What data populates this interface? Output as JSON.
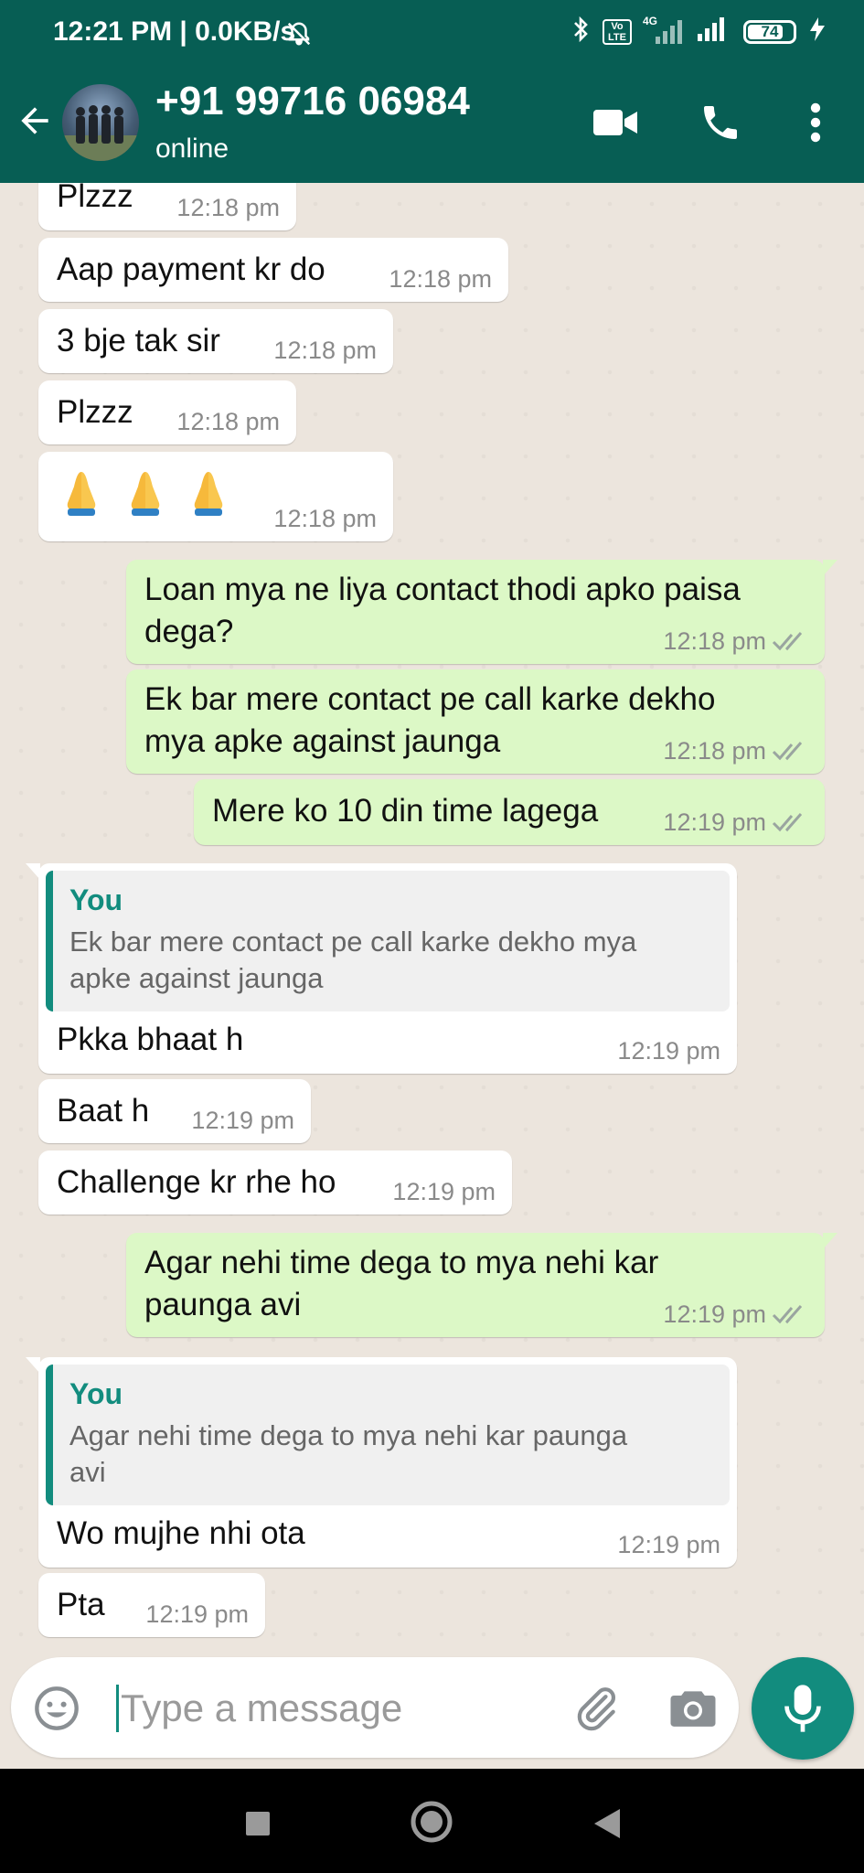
{
  "status_bar": {
    "time_speed": "12:21 PM | 0.0KB/s",
    "network": "4G",
    "volte": "Vo LTE",
    "battery": "74"
  },
  "header": {
    "contact_name": "+91 99716 06984",
    "status": "online"
  },
  "messages": [
    {
      "dir": "in",
      "text": "Plzzz",
      "time": "12:18 pm"
    },
    {
      "dir": "in",
      "text": "Aap payment kr do",
      "time": "12:18 pm"
    },
    {
      "dir": "in",
      "text": "3 bje tak sir",
      "time": "12:18 pm"
    },
    {
      "dir": "in",
      "text": "Plzzz",
      "time": "12:18 pm"
    },
    {
      "dir": "in",
      "emoji": "folded-hands x3",
      "time": "12:18 pm"
    },
    {
      "dir": "out",
      "text": "Loan mya ne liya contact thodi apko paisa\ndega?",
      "time": "12:18 pm"
    },
    {
      "dir": "out",
      "text": "Ek bar mere contact pe call karke dekho\nmya apke against jaunga",
      "time": "12:18 pm"
    },
    {
      "dir": "out",
      "text": "Mere ko 10 din time lagega",
      "time": "12:19 pm"
    },
    {
      "dir": "in",
      "quote_name": "You",
      "quote_text": "Ek bar mere contact pe call karke dekho mya\napke against jaunga",
      "text": "Pkka bhaat h",
      "time": "12:19 pm"
    },
    {
      "dir": "in",
      "text": "Baat h",
      "time": "12:19 pm"
    },
    {
      "dir": "in",
      "text": "Challenge kr rhe ho",
      "time": "12:19 pm"
    },
    {
      "dir": "out",
      "text": "Agar nehi time dega to mya nehi kar\npaunga avi",
      "time": "12:19 pm"
    },
    {
      "dir": "in",
      "quote_name": "You",
      "quote_text": "Agar nehi time dega to mya nehi kar paunga\navi",
      "text": "Wo mujhe nhi ota",
      "time": "12:19 pm"
    },
    {
      "dir": "in",
      "text": "Pta",
      "time": "12:19 pm"
    }
  ],
  "input": {
    "placeholder": "Type a message"
  },
  "colors": {
    "header": "#075e54",
    "accent": "#128c7e",
    "outgoing_bubble": "#dcf8c6",
    "incoming_bubble": "#ffffff",
    "chat_background": "#ece5dd",
    "read_ticks": "#9aa5a0"
  },
  "icons": {
    "back": "arrow-left-icon",
    "video": "video-call-icon",
    "call": "phone-icon",
    "menu": "more-vert-icon",
    "emoji": "smiley-icon",
    "attach": "paperclip-icon",
    "camera": "camera-icon",
    "mic": "mic-icon",
    "ticks": "double-check-icon"
  }
}
